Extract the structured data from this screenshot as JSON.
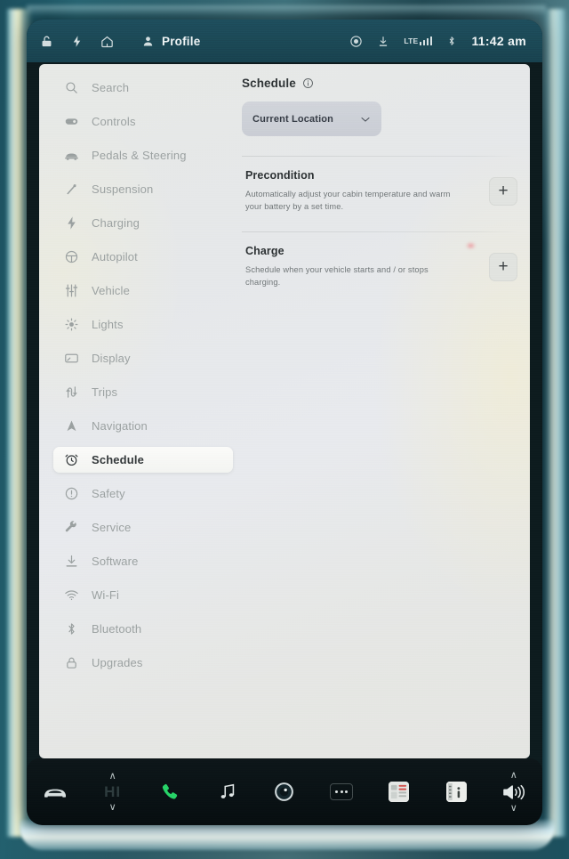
{
  "statusbar": {
    "left_icons": [
      {
        "name": "lock-icon",
        "glyph": "lock"
      },
      {
        "name": "charge-bolt-icon",
        "glyph": "bolt"
      },
      {
        "name": "home-icon",
        "glyph": "home"
      }
    ],
    "profile_label": "Profile",
    "profile_icon": "person-icon",
    "right_icons": [
      {
        "name": "recording-circle-icon"
      },
      {
        "name": "download-icon"
      },
      {
        "name": "lte-signal-icon"
      },
      {
        "name": "bluetooth-icon"
      }
    ],
    "network_label": "LTE",
    "signal_bars": 4,
    "clock": "11:42 am"
  },
  "sidebar": {
    "items": [
      {
        "label": "Search",
        "icon": "search-icon",
        "active": false
      },
      {
        "label": "Controls",
        "icon": "toggle-icon",
        "active": false
      },
      {
        "label": "Pedals & Steering",
        "icon": "pedals-icon",
        "active": false
      },
      {
        "label": "Suspension",
        "icon": "suspension-icon",
        "active": false
      },
      {
        "label": "Charging",
        "icon": "bolt-icon",
        "active": false
      },
      {
        "label": "Autopilot",
        "icon": "steering-wheel-icon",
        "active": false
      },
      {
        "label": "Vehicle",
        "icon": "sliders-icon",
        "active": false
      },
      {
        "label": "Lights",
        "icon": "light-icon",
        "active": false
      },
      {
        "label": "Display",
        "icon": "display-icon",
        "active": false
      },
      {
        "label": "Trips",
        "icon": "trips-icon",
        "active": false
      },
      {
        "label": "Navigation",
        "icon": "navigation-icon",
        "active": false
      },
      {
        "label": "Schedule",
        "icon": "alarm-clock-icon",
        "active": true
      },
      {
        "label": "Safety",
        "icon": "warning-icon",
        "active": false
      },
      {
        "label": "Service",
        "icon": "wrench-icon",
        "active": false
      },
      {
        "label": "Software",
        "icon": "download-icon",
        "active": false
      },
      {
        "label": "Wi-Fi",
        "icon": "wifi-icon",
        "active": false
      },
      {
        "label": "Bluetooth",
        "icon": "bluetooth-icon",
        "active": false
      },
      {
        "label": "Upgrades",
        "icon": "lock-icon",
        "active": false
      }
    ]
  },
  "main": {
    "title": "Schedule",
    "info_icon": "info-icon",
    "location_select": {
      "value": "Current Location",
      "chevron": "chevron-down-icon"
    },
    "sections": [
      {
        "heading": "Precondition",
        "description": "Automatically adjust your cabin temperature and warm your battery by a set time.",
        "add_label": "+"
      },
      {
        "heading": "Charge",
        "description": "Schedule when your vehicle starts and / or stops charging.",
        "add_label": "+"
      }
    ]
  },
  "dock": {
    "items": [
      {
        "name": "car-icon",
        "type": "icon"
      },
      {
        "name": "temperature-stepper",
        "type": "stepper",
        "value": "HI",
        "up": "∧",
        "down": "∨"
      },
      {
        "name": "phone-icon",
        "type": "icon",
        "color": "#26d367"
      },
      {
        "name": "music-note-icon",
        "type": "icon"
      },
      {
        "name": "camera-icon",
        "type": "icon"
      },
      {
        "name": "more-options-icon",
        "type": "dots"
      },
      {
        "name": "app-tile-seats-icon",
        "type": "tile"
      },
      {
        "name": "app-tile-info-icon",
        "type": "tile",
        "letter": "i"
      },
      {
        "name": "volume-stepper",
        "type": "stepper",
        "value": "speaker",
        "up": "∧",
        "down": "∨"
      }
    ]
  },
  "colors": {
    "accent_green": "#26d367",
    "statusbar_bg": "#1b4754",
    "panel_bg": "#e7e9e6",
    "dock_bg": "#091114",
    "active_text": "#33383a",
    "muted_text": "#9ba1a1"
  }
}
